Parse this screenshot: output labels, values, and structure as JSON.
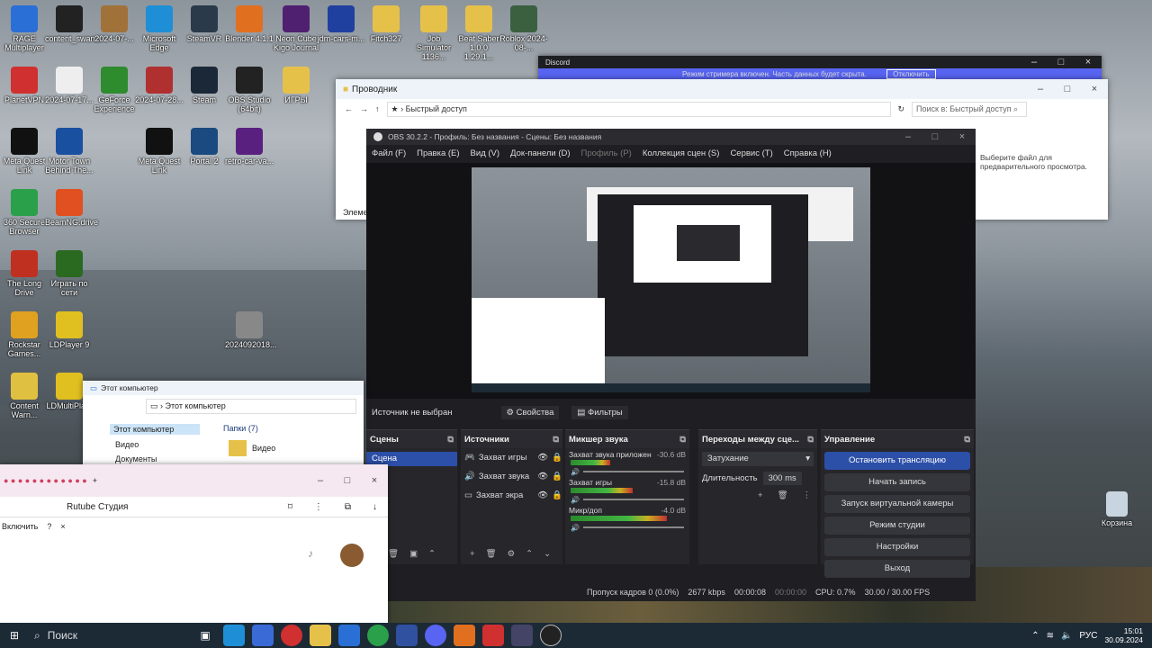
{
  "desktop_icons": [
    {
      "label": "RAGE Multiplayer",
      "color": "#2a6fd6"
    },
    {
      "label": "content_swan...",
      "color": "#222"
    },
    {
      "label": "2024-07-...",
      "color": "#a0723a"
    },
    {
      "label": "Microsoft Edge",
      "color": "#1e8fd6"
    },
    {
      "label": "SteamVR",
      "color": "#2a3a4a"
    },
    {
      "label": "Blender 4.1.1",
      "color": "#e07020"
    },
    {
      "label": "Neon Cube Kigo Journal",
      "color": "#502070"
    },
    {
      "label": "jdm-cars-m...",
      "color": "#2040a0"
    },
    {
      "label": "Fitch327",
      "color": "#e6c14a"
    },
    {
      "label": "Job Simulator 1136...",
      "color": "#e6c14a"
    },
    {
      "label": "Beat Saber 1.0.0 1.29.1...",
      "color": "#e6c14a"
    },
    {
      "label": "Roblox 2024-08-...",
      "color": "#3a6040"
    },
    {
      "label": "PlanetVPN",
      "color": "#d03030"
    },
    {
      "label": "2024-07-17...",
      "color": "#eee"
    },
    {
      "label": "GeForce Experience",
      "color": "#2e8b2e"
    },
    {
      "label": "2024-07-28...",
      "color": "#b03030"
    },
    {
      "label": "Steam",
      "color": "#1b2838"
    },
    {
      "label": "OBS Studio (64bit)",
      "color": "#222"
    },
    {
      "label": "ИГРЫ",
      "color": "#e6c14a"
    },
    {
      "label": "Meta Quest Link",
      "color": "#111"
    },
    {
      "label": "Motor Town Behind The...",
      "color": "#1a50a0"
    },
    {
      "label": "Meta Quest Link",
      "color": "#111"
    },
    {
      "label": "Portal 2",
      "color": "#1a4a80"
    },
    {
      "label": "retro-car-va...",
      "color": "#5a2080"
    },
    {
      "label": "360 Secure Browser",
      "color": "#2aa04a"
    },
    {
      "label": "BeamNG.drive",
      "color": "#e05020"
    },
    {
      "label": "The Long Drive",
      "color": "#c03020"
    },
    {
      "label": "Играть по сети",
      "color": "#2a6a20"
    },
    {
      "label": "Rockstar Games...",
      "color": "#e0a020"
    },
    {
      "label": "LDPlayer 9",
      "color": "#e0c020"
    },
    {
      "label": "2024092018...",
      "color": "#888"
    },
    {
      "label": "Content Warn...",
      "color": "#e0c040"
    },
    {
      "label": "LDMultiPla...",
      "color": "#e0c020"
    }
  ],
  "discord": {
    "title": "Discord",
    "banner": "Режим стримера включен. Часть данных будет скрыта.",
    "banner_btn": "Отключить"
  },
  "explorer1": {
    "title": "Проводник",
    "address": "Быстрый доступ",
    "search": "Поиск в: Быстрый доступ",
    "preview_hint": "Выберите файл для предварительного просмотра.",
    "left_label": "Элеме"
  },
  "explorer2": {
    "title": "Этот компьютер",
    "address": "Этот компьютер",
    "nav_items": [
      "Этот компьютер",
      "Видео",
      "Документы"
    ],
    "folders_header": "Папки (7)",
    "folder_video": "Видео"
  },
  "browser": {
    "page_title": "Rutube Студия",
    "enable_label": "Включить",
    "close_x": "×"
  },
  "obs": {
    "title": "OBS 30.2.2 - Профиль: Без названия - Сцены: Без названия",
    "menu": [
      "Файл (F)",
      "Правка (E)",
      "Вид (V)",
      "Док-панели (D)",
      "Профиль (P)",
      "Коллекция сцен (S)",
      "Сервис (T)",
      "Справка (H)"
    ],
    "source_status": "Источник не выбран",
    "props_label": "Свойства",
    "filters_label": "Фильтры",
    "scenes": {
      "header": "Сцены",
      "items": [
        "Сцена"
      ]
    },
    "sources": {
      "header": "Источники",
      "items": [
        "Захват игры",
        "Захват звука",
        "Захват экра"
      ]
    },
    "mixer": {
      "header": "Микшер звука",
      "channels": [
        {
          "name": "Захват звука приложен",
          "db": "-30.6 dB",
          "level": 0.35
        },
        {
          "name": "Захват игры",
          "db": "-15.8 dB",
          "level": 0.55
        },
        {
          "name": "Микр/доп",
          "db": "-4.0 dB",
          "level": 0.85
        }
      ]
    },
    "transitions": {
      "header": "Переходы между сце...",
      "selected": "Затухание",
      "duration_label": "Длительность",
      "duration": "300 ms"
    },
    "controls": {
      "header": "Управление",
      "buttons": [
        "Остановить трансляцию",
        "Начать запись",
        "Запуск виртуальной камеры",
        "Режим студии",
        "Настройки",
        "Выход"
      ]
    },
    "status": {
      "dropped": "Пропуск кадров 0 (0.0%)",
      "bitrate": "2677 kbps",
      "stream_time": "00:00:08",
      "rec_time": "00:00:00",
      "cpu": "CPU: 0.7%",
      "fps": "30.00 / 30.00 FPS"
    }
  },
  "recycle": {
    "label": "Корзина"
  },
  "taskbar": {
    "search": "Поиск",
    "lang": "РУС",
    "time": "15:01",
    "date": "30.09.2024"
  }
}
